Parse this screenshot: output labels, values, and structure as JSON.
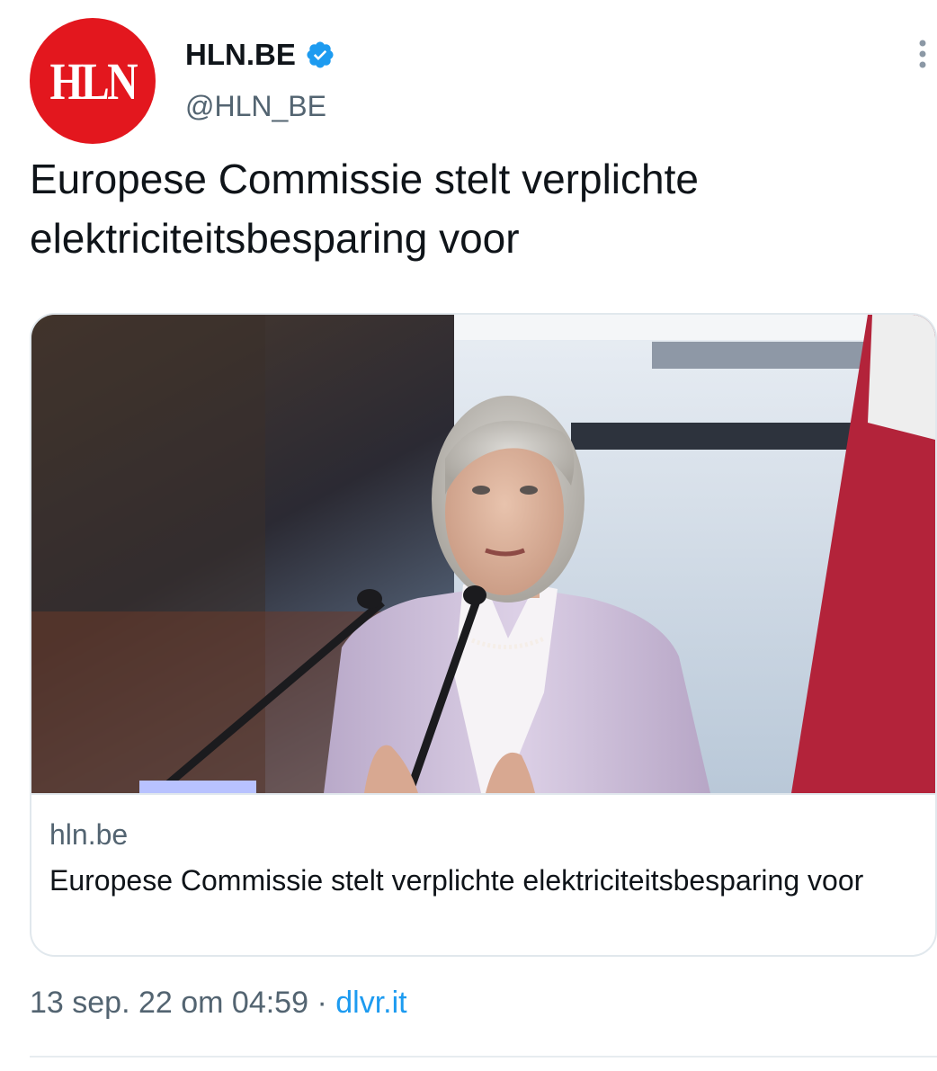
{
  "avatar": {
    "text": "HLN"
  },
  "author": {
    "display_name": "HLN.BE",
    "handle": "@HLN_BE",
    "verified": true
  },
  "tweet": {
    "text": "Europese Commissie stelt verplichte elektriciteitsbesparing voor"
  },
  "card": {
    "domain": "hln.be",
    "title": "Europese Commissie stelt verplichte elektriciteitsbesparing voor"
  },
  "meta": {
    "timestamp": "13 sep. 22 om 04:59",
    "separator": "·",
    "source": "dlvr.it"
  },
  "colors": {
    "brand_red": "#e3171e",
    "link_blue": "#1d9bf0",
    "verified_blue": "#1d9bf0",
    "secondary_text": "#536471"
  },
  "icons": {
    "verified": "verified-badge-icon",
    "more": "more-vertical-icon"
  }
}
